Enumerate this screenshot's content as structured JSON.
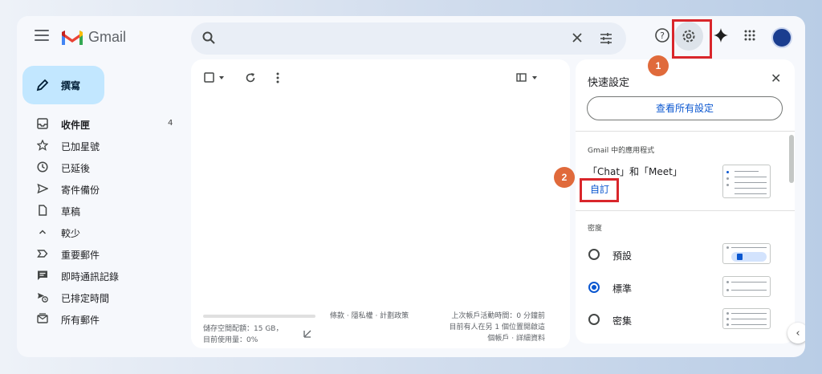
{
  "header": {
    "app_name": "Gmail",
    "icons": [
      "menu-icon",
      "search-icon",
      "clear-icon",
      "filter-options-icon",
      "help-icon",
      "settings-gear-icon",
      "gemini-sparkle-icon",
      "apps-grid-icon",
      "account-avatar"
    ]
  },
  "sidebar": {
    "compose_label": "撰寫",
    "items": [
      {
        "label": "收件匣",
        "icon": "inbox-icon",
        "count": "4",
        "bold": true
      },
      {
        "label": "已加星號",
        "icon": "star-icon"
      },
      {
        "label": "已延後",
        "icon": "clock-icon"
      },
      {
        "label": "寄件備份",
        "icon": "send-icon"
      },
      {
        "label": "草稿",
        "icon": "file-icon"
      },
      {
        "label": "較少",
        "icon": "chevron-up-icon"
      },
      {
        "label": "重要郵件",
        "icon": "label-important-icon"
      },
      {
        "label": "即時通訊記錄",
        "icon": "chat-icon"
      },
      {
        "label": "已排定時間",
        "icon": "scheduled-send-icon"
      },
      {
        "label": "所有郵件",
        "icon": "all-mail-icon"
      }
    ]
  },
  "main": {
    "storage_line1": "儲存空間配額：15 GB，",
    "storage_line2": "目前使用量：0%",
    "storage_used_fraction": 0.0,
    "policies": "條款 · 隱私權 · 計劃政策",
    "activity_line1": "上次帳戶活動時間：0 分鐘前",
    "activity_line2": "目前有人在另 1 個位置開啟這",
    "activity_line3": "個帳戶 · 詳細資料"
  },
  "quick_settings": {
    "title": "快速設定",
    "view_all": "查看所有設定",
    "apps_section": "Gmail 中的應用程式",
    "apps_label": "「Chat」和「Meet」",
    "customize": "自訂",
    "density_section": "密度",
    "density_options": [
      {
        "label": "預設",
        "selected": false
      },
      {
        "label": "標準",
        "selected": true
      },
      {
        "label": "密集",
        "selected": false
      }
    ]
  },
  "annotations": {
    "step1": "1",
    "step2": "2",
    "highlight_color": "#d9262b",
    "badge_color": "#e06a3b"
  },
  "colors": {
    "compose_bg": "#c2e7ff",
    "link_blue": "#0b57d0"
  }
}
